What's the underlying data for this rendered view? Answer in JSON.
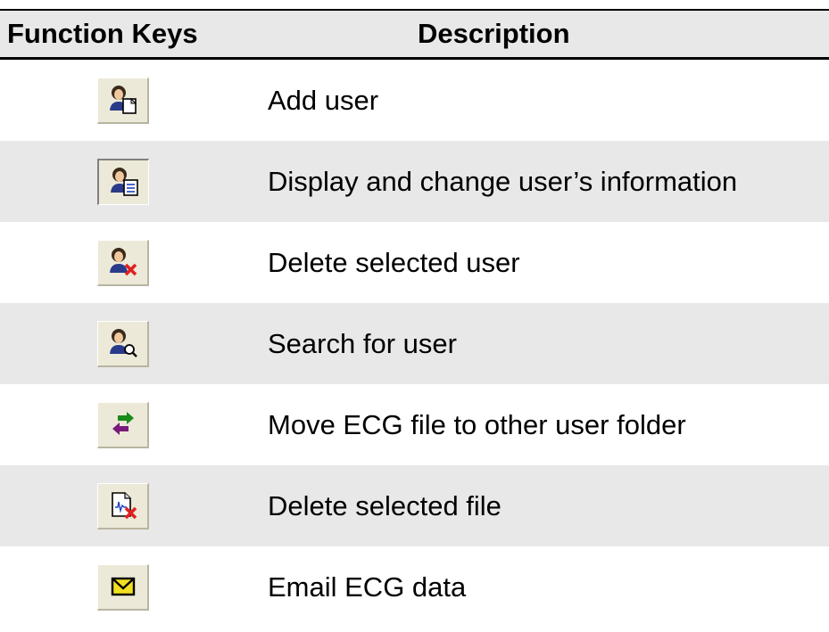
{
  "table": {
    "header": {
      "col_keys": "Function Keys",
      "col_desc": "Description"
    },
    "rows": [
      {
        "icon": "add-user-icon",
        "description": "Add user"
      },
      {
        "icon": "user-info-icon",
        "description": "Display and change user’s information"
      },
      {
        "icon": "delete-user-icon",
        "description": "Delete selected user"
      },
      {
        "icon": "search-user-icon",
        "description": "Search for user"
      },
      {
        "icon": "move-file-icon",
        "description": "Move ECG file to other user folder"
      },
      {
        "icon": "delete-file-icon",
        "description": "Delete selected file"
      },
      {
        "icon": "email-icon",
        "description": "Email ECG data"
      }
    ]
  },
  "colors": {
    "row_shade": "#e8e8e8",
    "button_face": "#ece9d8",
    "delete_red": "#e02020",
    "arrow_green": "#1a8a1a",
    "arrow_purple": "#7a1a7a",
    "envelope_yellow": "#f0e020"
  }
}
